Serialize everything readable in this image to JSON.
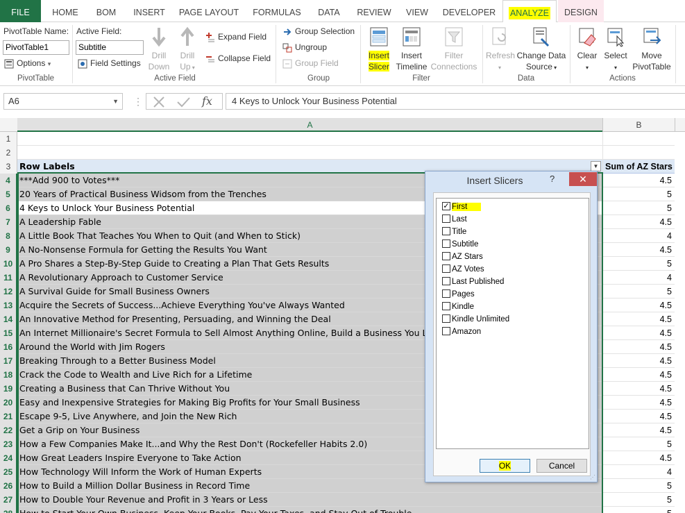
{
  "ribbon_tabs": [
    "FILE",
    "HOME",
    "BOM",
    "INSERT",
    "PAGE LAYOUT",
    "FORMULAS",
    "DATA",
    "REVIEW",
    "VIEW",
    "DEVELOPER",
    "ANALYZE",
    "DESIGN"
  ],
  "pivottable_group": {
    "name_label": "PivotTable Name:",
    "name_value": "PivotTable1",
    "options_label": "Options",
    "group_label": "PivotTable"
  },
  "active_field_group": {
    "field_label": "Active Field:",
    "field_value": "Subtitle",
    "field_settings_label": "Field Settings",
    "drill_down": [
      "Drill",
      "Down"
    ],
    "drill_up": [
      "Drill",
      "Up"
    ],
    "expand_label": "Expand Field",
    "collapse_label": "Collapse Field",
    "group_label": "Active Field"
  },
  "group_group": {
    "selection_label": "Group Selection",
    "ungroup_label": "Ungroup",
    "field_label": "Group Field",
    "group_label": "Group"
  },
  "filter_group": {
    "insert_slicer": [
      "Insert",
      "Slicer"
    ],
    "insert_timeline": [
      "Insert",
      "Timeline"
    ],
    "filter_connections": [
      "Filter",
      "Connections"
    ],
    "group_label": "Filter"
  },
  "data_group": {
    "refresh": "Refresh",
    "change_source": [
      "Change Data",
      "Source"
    ],
    "group_label": "Data"
  },
  "actions_group": {
    "clear": "Clear",
    "select": "Select",
    "move": [
      "Move",
      "PivotTable"
    ],
    "group_label": "Actions"
  },
  "formula_bar": {
    "name_box": "A6",
    "fx": "fx",
    "formula": "4 Keys to Unlock Your Business Potential"
  },
  "columns": [
    "A",
    "B"
  ],
  "header_row": {
    "row": "3",
    "a": "Row Labels",
    "b": "Sum of AZ Stars"
  },
  "blank_rows": [
    "1",
    "2"
  ],
  "rows": [
    {
      "row": "4",
      "a": "***Add 900 to Votes***",
      "b": "4.5"
    },
    {
      "row": "5",
      "a": "20 Years of Practical Business Widsom from the Trenches",
      "b": "5"
    },
    {
      "row": "6",
      "a": "4 Keys to Unlock Your Business Potential",
      "b": "5"
    },
    {
      "row": "7",
      "a": "A Leadership Fable",
      "b": "4.5"
    },
    {
      "row": "8",
      "a": "A Little Book That Teaches You When to Quit (and When to Stick)",
      "b": "4"
    },
    {
      "row": "9",
      "a": "A No-Nonsense Formula for Getting the Results You Want",
      "b": "4.5"
    },
    {
      "row": "10",
      "a": "A Pro Shares a Step-By-Step Guide to Creating a Plan That Gets Results",
      "b": "5"
    },
    {
      "row": "11",
      "a": "A Revolutionary Approach to Customer Service",
      "b": "4"
    },
    {
      "row": "12",
      "a": "A Survival Guide for Small Business Owners",
      "b": "5"
    },
    {
      "row": "13",
      "a": "Acquire the Secrets of Success...Achieve Everything You've Always Wanted",
      "b": "4.5"
    },
    {
      "row": "14",
      "a": "An Innovative Method for Presenting, Persuading, and Winning the Deal",
      "b": "4.5"
    },
    {
      "row": "15",
      "a": "An Internet Millionaire's Secret Formula to Sell Almost Anything Online, Build a Business You Lo",
      "b": "4.5"
    },
    {
      "row": "16",
      "a": "Around the World with Jim Rogers",
      "b": "4.5"
    },
    {
      "row": "17",
      "a": "Breaking Through to a Better Business Model",
      "b": "4.5"
    },
    {
      "row": "18",
      "a": "Crack the Code to Wealth and Live Rich for a Lifetime",
      "b": "4.5"
    },
    {
      "row": "19",
      "a": "Creating a Business that Can Thrive Without You",
      "b": "4.5"
    },
    {
      "row": "20",
      "a": "Easy and Inexpensive Strategies for Making Big Profits for Your Small Business",
      "b": "4.5"
    },
    {
      "row": "21",
      "a": "Escape 9-5, Live Anywhere, and Join the New Rich",
      "b": "4.5"
    },
    {
      "row": "22",
      "a": "Get a Grip on Your Business",
      "b": "4.5"
    },
    {
      "row": "23",
      "a": "How a Few Companies Make It...and Why the Rest Don't (Rockefeller Habits 2.0)",
      "b": "5"
    },
    {
      "row": "24",
      "a": "How Great Leaders Inspire Everyone to Take Action",
      "b": "4.5"
    },
    {
      "row": "25",
      "a": "How Technology Will Inform the Work of Human Experts",
      "b": "4"
    },
    {
      "row": "26",
      "a": "How to Build a Million Dollar Business in Record Time",
      "b": "5"
    },
    {
      "row": "27",
      "a": "How to Double Your Revenue and Profit in 3 Years or Less",
      "b": "5"
    },
    {
      "row": "28",
      "a": "How to Start Your Own Business, Keep Your Books, Pay Your Taxes, and Stay Out of Trouble",
      "b": "5"
    }
  ],
  "dialog": {
    "title": "Insert Slicers",
    "help": "?",
    "close": "✕",
    "fields": [
      {
        "label": "First",
        "checked": true
      },
      {
        "label": "Last",
        "checked": false
      },
      {
        "label": "Title",
        "checked": false
      },
      {
        "label": "Subtitle",
        "checked": false
      },
      {
        "label": "AZ Stars",
        "checked": false
      },
      {
        "label": "AZ Votes",
        "checked": false
      },
      {
        "label": "Last Published",
        "checked": false
      },
      {
        "label": "Pages",
        "checked": false
      },
      {
        "label": "Kindle",
        "checked": false
      },
      {
        "label": "Kindle Unlimited",
        "checked": false
      },
      {
        "label": "Amazon",
        "checked": false
      }
    ],
    "ok": "OK",
    "cancel": "Cancel"
  },
  "colors": {
    "excel_green": "#217346",
    "highlight": "#ffff00",
    "dialog_bg": "#d6e4f5",
    "selected_row_fill": "#d0d0d0"
  }
}
